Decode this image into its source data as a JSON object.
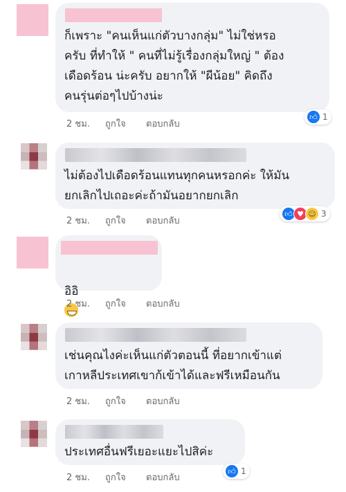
{
  "comments": [
    {
      "text": "ก็เพราะ \"คนเห็นแก่ตัวบางกลุ่ม\"  ไม่ใช่หรอ\nครับ ที่ทำให้ \" คนที่ไม่รู้เรื่องกลุ่มใหญ่ \" ต้อง\nเดือดร้อน น่ะครับ อยากให้ \"ผีน้อย\" คิดถึง\nคนรุ่นต่อๆไปบ้างน่ะ",
      "time": "2 ชม.",
      "like": "ถูกใจ",
      "reply": "ตอบกลับ",
      "reaction_count": "1"
    },
    {
      "text": "ไม่ต้องไปเดือดร้อนแทนทุกคนหรอกค่ะ ให้มัน\nยกเลิกไปเถอะค่ะถ้ามันอยากยกเลิก",
      "time": "2 ชม.",
      "like": "ถูกใจ",
      "reply": "ตอบกลับ",
      "reaction_count": "3"
    },
    {
      "text": "อิอิ",
      "time": "2 ชม.",
      "like": "ถูกใจ",
      "reply": "ตอบกลับ"
    },
    {
      "text": "เช่นคุณไงค่ะเห็นแก่ตัวตอนนี้ ที่อยากเข้าแต่\nเกาหลีประเทศเขาก้เข้าได้และฟรีเหมือนกัน",
      "time": "2 ชม.",
      "like": "ถูกใจ",
      "reply": "ตอบกลับ"
    },
    {
      "text": "ประเทศอื่นฟรีเยอะแยะไปสิค่ะ",
      "time": "2 ชม.",
      "like": "ถูกใจ",
      "reply": "ตอบกลับ",
      "reaction_count": "1"
    }
  ],
  "icons": {
    "like": "thumbs-up-icon",
    "love": "heart-icon",
    "haha": "laughing-face-icon",
    "grin_emoji": "grinning-emoji-icon"
  },
  "colors": {
    "bubble": "#f0f2f5",
    "like_blue": "#1877f2",
    "love_red": "#f33e58",
    "haha_yellow": "#f7c845",
    "meta_gray": "#65676b",
    "redacted_pink": "#f7c3d2"
  }
}
